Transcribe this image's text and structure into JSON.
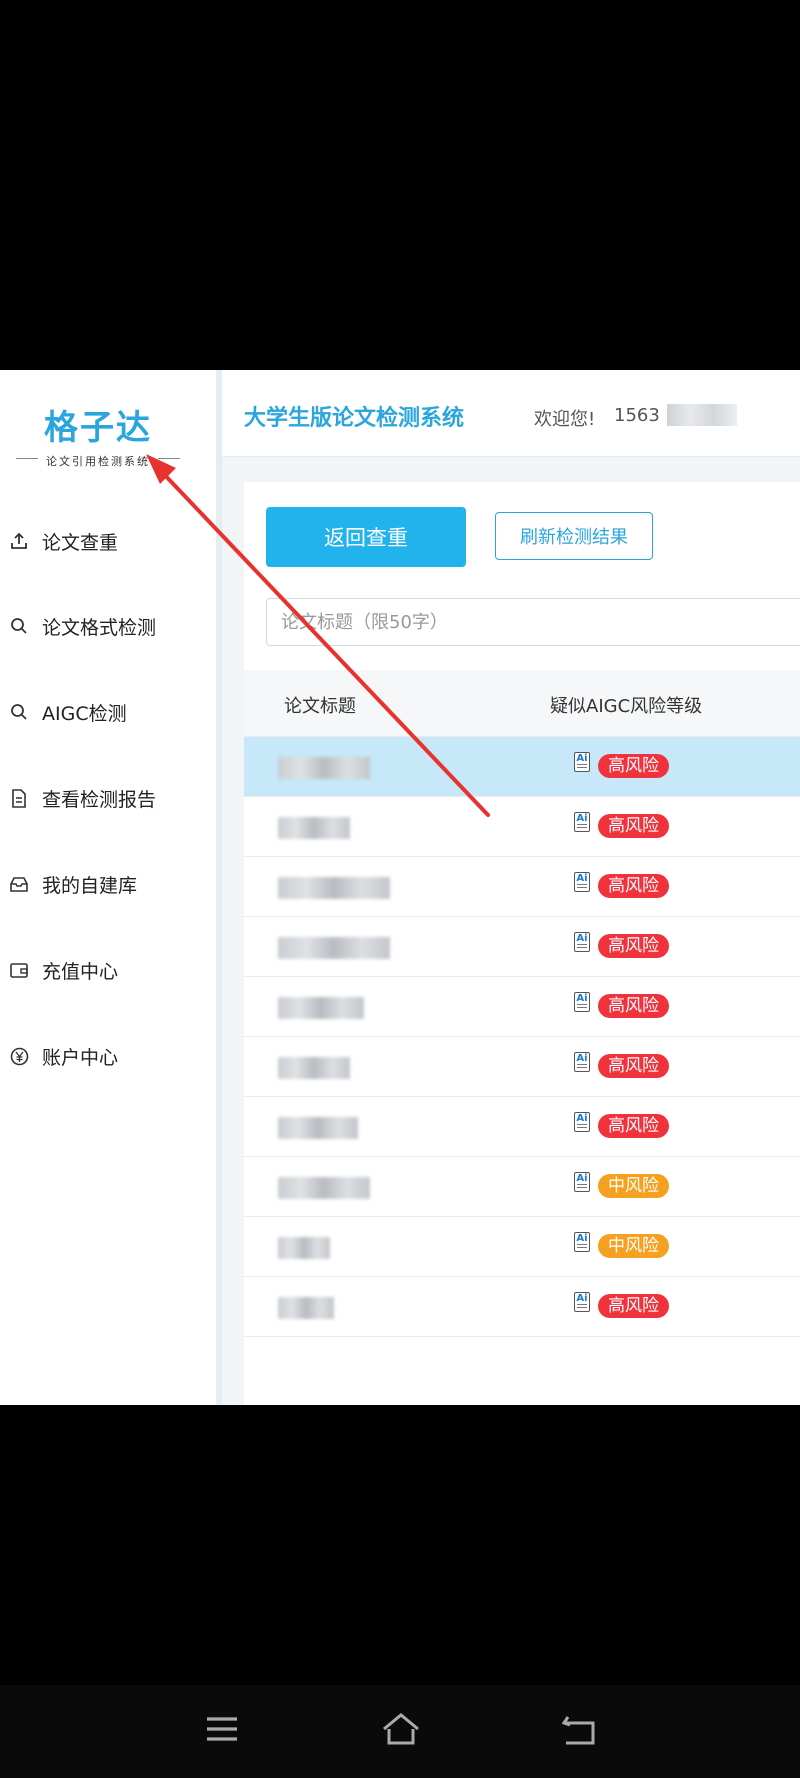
{
  "sidebar": {
    "logo": {
      "main": "格子达",
      "sub": "论文引用检测系统"
    },
    "items": [
      {
        "label": "论文查重",
        "icon": "upload-icon"
      },
      {
        "label": "论文格式检测",
        "icon": "search-icon"
      },
      {
        "label": "AIGC检测",
        "icon": "search-icon"
      },
      {
        "label": "查看检测报告",
        "icon": "document-icon"
      },
      {
        "label": "我的自建库",
        "icon": "inbox-icon"
      },
      {
        "label": "充值中心",
        "icon": "wallet-icon"
      },
      {
        "label": "账户中心",
        "icon": "yen-icon"
      }
    ]
  },
  "header": {
    "title": "大学生版论文检测系统",
    "welcome": "欢迎您!",
    "user_prefix": "1563"
  },
  "toolbar": {
    "return_label": "返回查重",
    "refresh_label": "刷新检测结果",
    "search_placeholder": "论文标题（限50字）"
  },
  "table": {
    "columns": [
      "论文标题",
      "疑似AIGC风险等级"
    ],
    "rows": [
      {
        "risk": "高风险",
        "level": "high",
        "selected": true
      },
      {
        "risk": "高风险",
        "level": "high",
        "selected": false
      },
      {
        "risk": "高风险",
        "level": "high",
        "selected": false
      },
      {
        "risk": "高风险",
        "level": "high",
        "selected": false
      },
      {
        "risk": "高风险",
        "level": "high",
        "selected": false
      },
      {
        "risk": "高风险",
        "level": "high",
        "selected": false
      },
      {
        "risk": "高风险",
        "level": "high",
        "selected": false
      },
      {
        "risk": "中风险",
        "level": "medium",
        "selected": false
      },
      {
        "risk": "中风险",
        "level": "medium",
        "selected": false
      },
      {
        "risk": "高风险",
        "level": "high",
        "selected": false
      }
    ],
    "ai_icon_text": "Ai"
  },
  "colors": {
    "accent": "#2aa6dc",
    "high": "#f0323c",
    "medium": "#f5a01e",
    "annotation_arrow": "#e8322d"
  }
}
